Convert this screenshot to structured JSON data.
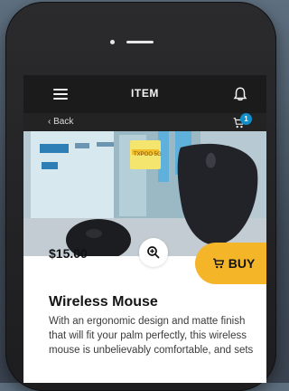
{
  "header": {
    "title": "ITEM",
    "back_label": "‹ Back",
    "cart_count": "1"
  },
  "product": {
    "price": "$15.00",
    "buy_label": "BUY",
    "title": "Wireless Mouse",
    "description": "With an ergonomic design and matte finish that will fit your palm perfectly, this wireless mouse is unbelievably comfortable, and sets"
  },
  "icons": {
    "menu": "hamburger-icon",
    "notifications": "bell-icon",
    "cart": "cart-icon",
    "zoom": "zoom-in-icon",
    "buy": "cart-icon"
  },
  "colors": {
    "accent": "#f4b528",
    "badge": "#0f8ec7",
    "topbar": "#1b1b1c"
  }
}
